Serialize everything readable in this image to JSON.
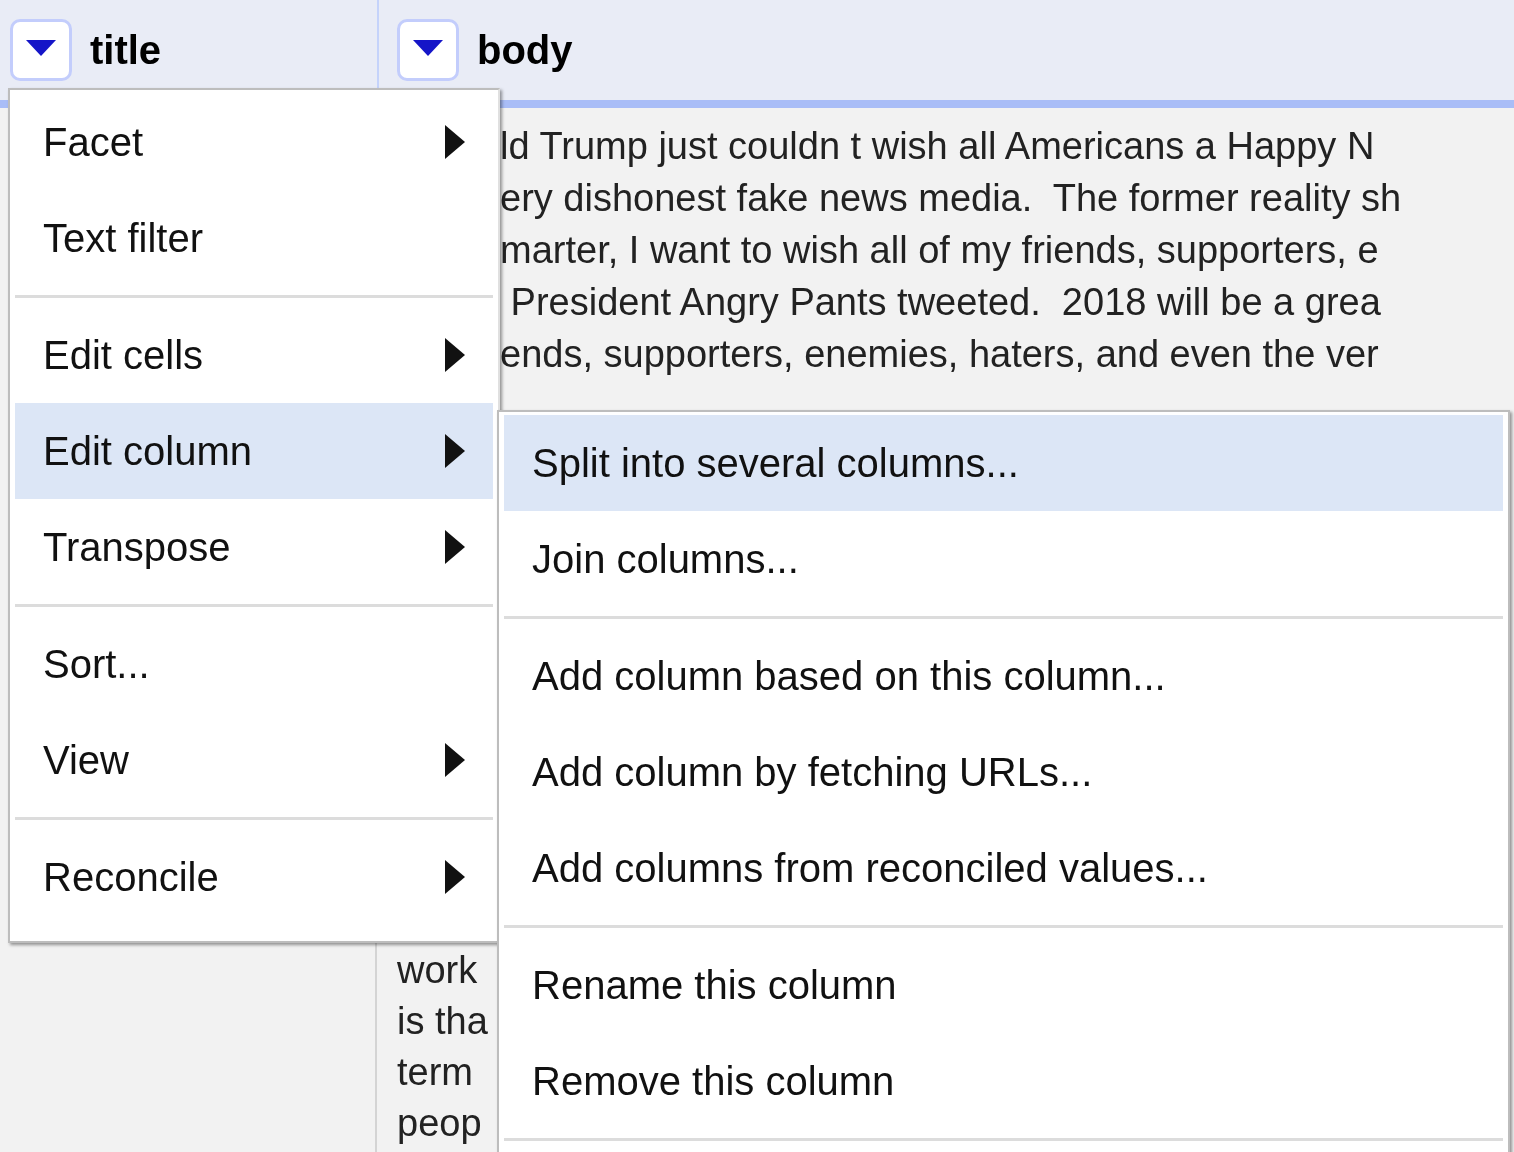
{
  "columns": [
    {
      "name": "title"
    },
    {
      "name": "body"
    }
  ],
  "rows": [
    {
      "body_lines": [
        "ld Trump just couldn t wish all Americans a Happy N",
        "ery dishonest fake news media.  The former reality sh",
        "marter, I want to wish all of my friends, supporters, e",
        " President Angry Pants tweeted.  2018 will be a grea",
        "ends, supporters, enemies, haters, and even the ver"
      ]
    },
    {
      "body_lines": [
        "work",
        "is tha",
        "term",
        "peop"
      ]
    }
  ],
  "column_menu": {
    "items": [
      {
        "kind": "item",
        "label": "Facet",
        "submenu": true,
        "selected": false
      },
      {
        "kind": "item",
        "label": "Text filter",
        "submenu": false,
        "selected": false
      },
      {
        "kind": "separator"
      },
      {
        "kind": "item",
        "label": "Edit cells",
        "submenu": true,
        "selected": false
      },
      {
        "kind": "item",
        "label": "Edit column",
        "submenu": true,
        "selected": true
      },
      {
        "kind": "item",
        "label": "Transpose",
        "submenu": true,
        "selected": false
      },
      {
        "kind": "separator"
      },
      {
        "kind": "item",
        "label": "Sort...",
        "submenu": false,
        "selected": false
      },
      {
        "kind": "item",
        "label": "View",
        "submenu": true,
        "selected": false
      },
      {
        "kind": "separator"
      },
      {
        "kind": "item",
        "label": "Reconcile",
        "submenu": true,
        "selected": false
      }
    ]
  },
  "submenu": {
    "items": [
      {
        "kind": "item",
        "label": "Split into several columns...",
        "selected": true
      },
      {
        "kind": "item",
        "label": "Join columns...",
        "selected": false
      },
      {
        "kind": "separator"
      },
      {
        "kind": "item",
        "label": "Add column based on this column...",
        "selected": false
      },
      {
        "kind": "item",
        "label": "Add column by fetching URLs...",
        "selected": false
      },
      {
        "kind": "item",
        "label": "Add columns from reconciled values...",
        "selected": false
      },
      {
        "kind": "separator"
      },
      {
        "kind": "item",
        "label": "Rename this column",
        "selected": false
      },
      {
        "kind": "item",
        "label": "Remove this column",
        "selected": false
      },
      {
        "kind": "separator"
      }
    ]
  }
}
